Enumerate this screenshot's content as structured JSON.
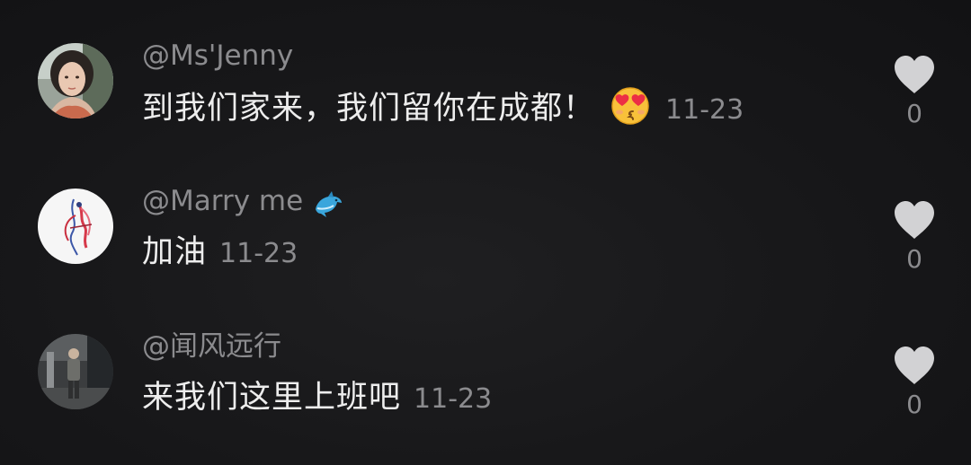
{
  "comments": [
    {
      "username": "@Ms'Jenny",
      "badge": "",
      "text": "到我们家来，我们留你在成都！",
      "emoji": "heart-eyes-kiss-emoji",
      "date": "11-23",
      "likes": "0"
    },
    {
      "username": "@Marry me",
      "badge": "🐬",
      "text": "加油",
      "emoji": "",
      "date": "11-23",
      "likes": "0"
    },
    {
      "username": "@闻风远行",
      "badge": "",
      "text": "来我们这里上班吧",
      "emoji": "",
      "date": "11-23",
      "likes": "0"
    }
  ],
  "icons": {
    "like": "heart-icon"
  },
  "colors": {
    "background": "#161618",
    "primary_text": "#ededed",
    "secondary_text": "#8b8b8e",
    "heart": "#d2d2d4"
  }
}
